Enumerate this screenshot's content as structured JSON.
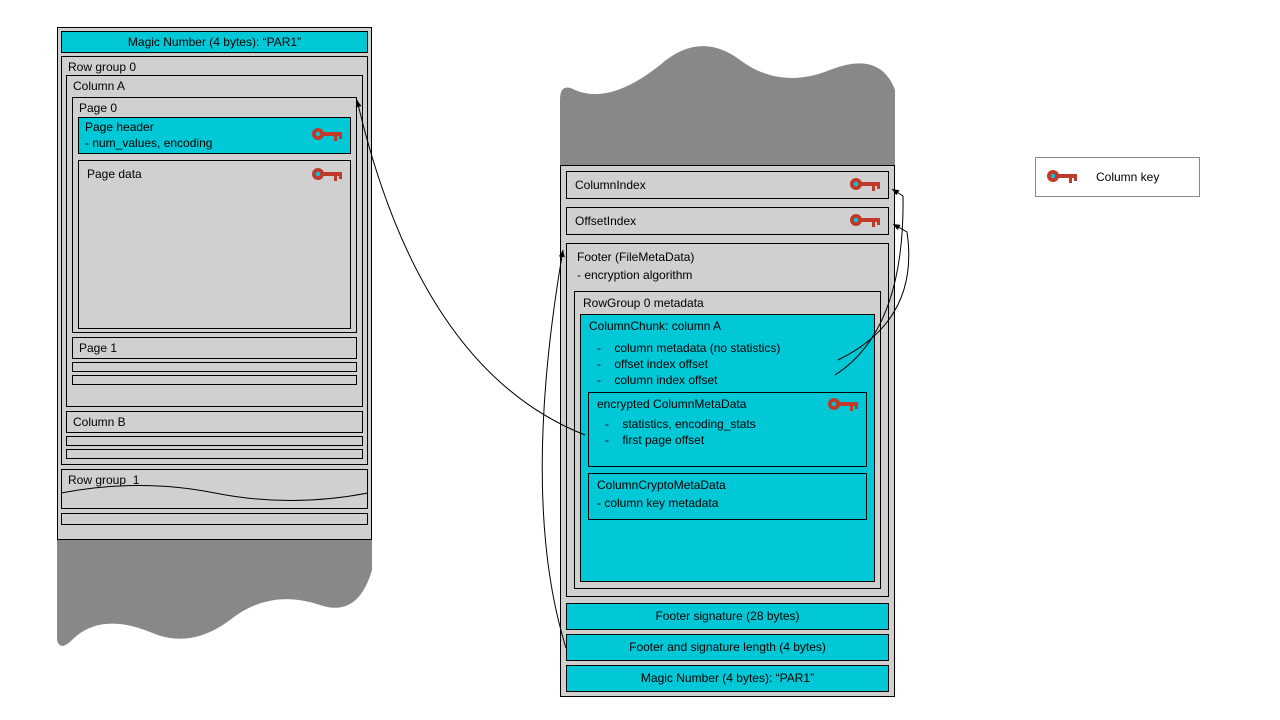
{
  "left": {
    "magic_top": "Magic Number (4 bytes): “PAR1”",
    "rowgroup0": "Row group 0",
    "columnA": "Column A",
    "page0": "Page 0",
    "page_header_l1": "Page header",
    "page_header_l2": "- num_values, encoding",
    "page_data": "Page data",
    "page1": "Page 1",
    "columnB": "Column B",
    "rowgroup1": "Row group  1"
  },
  "right": {
    "column_index": "ColumnIndex",
    "offset_index": "OffsetIndex",
    "footer_l1": "Footer (FileMetaData)",
    "footer_l2": "- encryption algorithm",
    "rowgroup0_meta": "RowGroup 0 metadata",
    "cc_title": "ColumnChunk: column A",
    "cc_b1": "-    column metadata (no statistics)",
    "cc_b2": "-    offset index offset",
    "cc_b3": "-    column index offset",
    "ecm_title": "encrypted ColumnMetaData",
    "ecm_b1": "-    statistics, encoding_stats",
    "ecm_b2": "-    first page offset",
    "ccm_title": "ColumnCryptoMetaData",
    "ccm_b1": "- column key metadata",
    "footer_sig": "Footer signature (28 bytes)",
    "footer_len": "Footer and signature length (4 bytes)",
    "magic_bottom": "Magic Number (4 bytes): “PAR1”"
  },
  "legend": {
    "label": "Column key"
  }
}
